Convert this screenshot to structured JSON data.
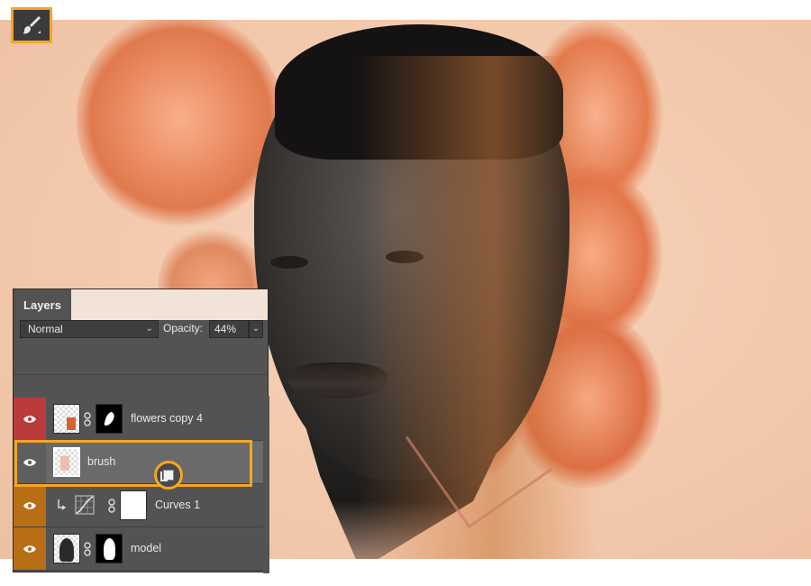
{
  "tool": {
    "icon": "brush-tool-icon"
  },
  "layers_panel": {
    "tab_label": "Layers",
    "blend_mode": "Normal",
    "opacity_label": "Opacity:",
    "opacity_value": "44%",
    "layers": [
      {
        "name": "flowers copy 4",
        "eye_bg": "#b93b3b"
      },
      {
        "name": "brush",
        "eye_bg": "#5e5e5e",
        "selected": true
      },
      {
        "name": "Curves 1",
        "eye_bg": "#b86e14"
      },
      {
        "name": "model",
        "eye_bg": "#b86e14"
      }
    ]
  },
  "colors": {
    "highlight": "#f5a623",
    "panel_bg": "#535353",
    "canvas_bg": "#f3c9ad"
  }
}
